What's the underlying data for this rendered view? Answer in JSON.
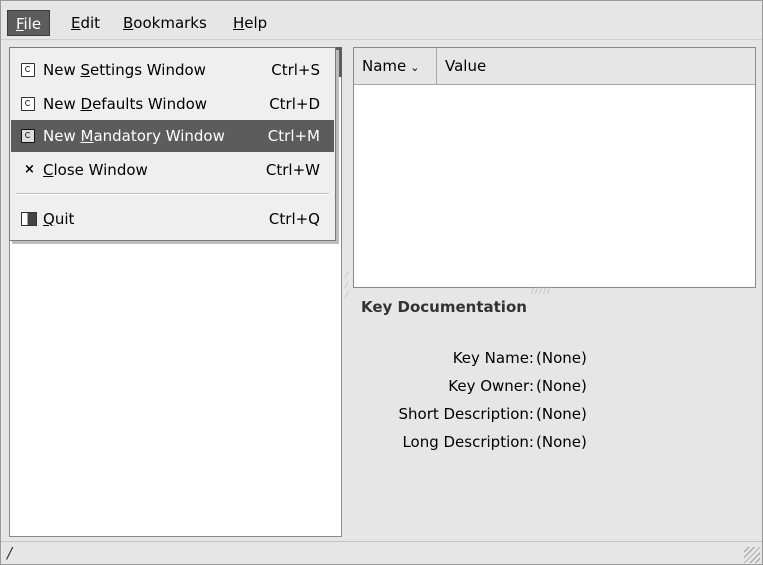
{
  "menubar": {
    "items": [
      {
        "label": "File",
        "mnemonic": "F",
        "rest": "ile"
      },
      {
        "label": "Edit",
        "mnemonic": "E",
        "rest": "dit"
      },
      {
        "label": "Bookmarks",
        "mnemonic": "B",
        "rest": "ookmarks"
      },
      {
        "label": "Help",
        "mnemonic": "H",
        "rest": "elp"
      }
    ]
  },
  "file_menu": {
    "items": [
      {
        "pre": "New ",
        "mnemonic": "S",
        "post": "ettings Window",
        "accel": "Ctrl+S",
        "icon": "new-window-icon"
      },
      {
        "pre": "New ",
        "mnemonic": "D",
        "post": "efaults Window",
        "accel": "Ctrl+D",
        "icon": "new-window-icon"
      },
      {
        "pre": "New ",
        "mnemonic": "M",
        "post": "andatory Window",
        "accel": "Ctrl+M",
        "icon": "new-window-icon"
      },
      {
        "pre": "",
        "mnemonic": "C",
        "post": "lose Window",
        "accel": "Ctrl+W",
        "icon": "close-icon"
      },
      {
        "pre": "",
        "mnemonic": "Q",
        "post": "uit",
        "accel": "Ctrl+Q",
        "icon": "quit-icon"
      }
    ]
  },
  "value_list": {
    "col_name": "Name",
    "col_name_chevron": "⌄",
    "col_value": "Value"
  },
  "key_doc": {
    "title": "Key Documentation",
    "rows": [
      {
        "label": "Key Name:",
        "value": "(None)"
      },
      {
        "label": "Key Owner:",
        "value": "(None)"
      },
      {
        "label": "Short Description:",
        "value": "(None)"
      },
      {
        "label": "Long Description:",
        "value": "(None)"
      }
    ]
  },
  "statusbar": {
    "text": "/"
  },
  "colors": {
    "window_bg": "#e6e6e6",
    "highlight": "#5c5c5c",
    "pane_bg": "#ffffff"
  }
}
